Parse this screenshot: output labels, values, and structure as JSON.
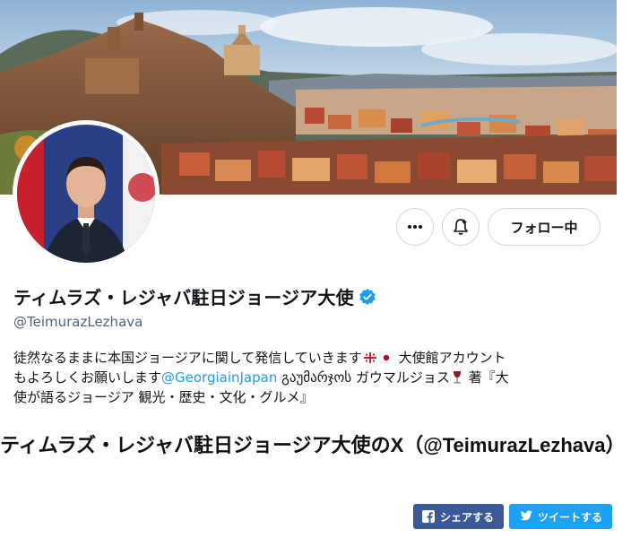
{
  "profile": {
    "display_name": "ティムラズ・レジャバ駐日ジョージア大使",
    "handle": "@TeimurazLezhava",
    "bio": {
      "line1_text": "徒然なるままに本国ジョージアに関して発信していきます",
      "line1_after": "大使館アカウント",
      "line2_prefix": "もよろしくお願いします",
      "mention": "@GeorgiainJapan",
      "line2_suffix": " გაუმარჯოს ガウマルジョス",
      "line2_end": " 著『大",
      "line3": "使が語るジョージア 観光・歴史・文化・グルメ』"
    }
  },
  "actions": {
    "more_icon": "more-dots-icon",
    "notify_icon": "bell-plus-icon",
    "follow_label": "フォロー中"
  },
  "colors": {
    "link": "#1d9bf0",
    "verified": "#1d9bf0",
    "facebook": "#3b5998",
    "twitter": "#1da1f2"
  },
  "article": {
    "title": "ティムラズ・レジャバ駐日ジョージア大使のX（@TeimurazLezhava）"
  },
  "share": {
    "facebook_label": "シェアする",
    "twitter_label": "ツイートする"
  }
}
